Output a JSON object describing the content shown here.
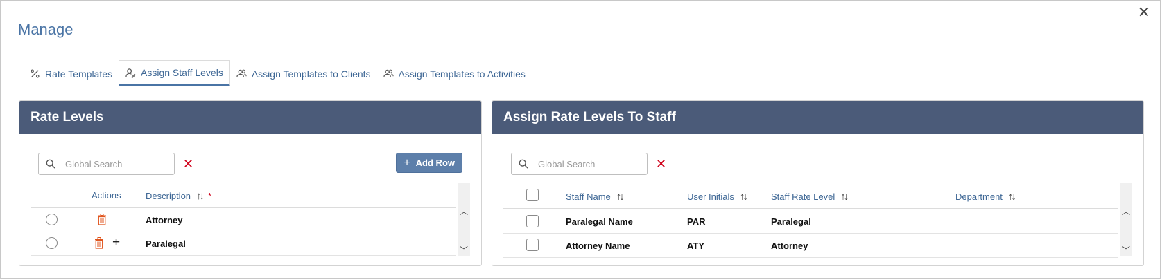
{
  "dialog": {
    "title": "Manage",
    "close_glyph": "✕"
  },
  "tabs": [
    {
      "label": "Rate Templates",
      "icon": "percent-icon",
      "active": false
    },
    {
      "label": "Assign Staff Levels",
      "icon": "user-edit-icon",
      "active": true
    },
    {
      "label": "Assign Templates to Clients",
      "icon": "users-icon",
      "active": false
    },
    {
      "label": "Assign Templates to Activities",
      "icon": "users-icon",
      "active": false
    }
  ],
  "rate_levels": {
    "title": "Rate Levels",
    "search_placeholder": "Global Search",
    "add_row_label": "Add Row",
    "columns": {
      "actions": "Actions",
      "description": "Description",
      "required_mark": "*"
    },
    "rows": [
      {
        "description": "Attorney"
      },
      {
        "description": "Paralegal"
      }
    ]
  },
  "assign_staff": {
    "title": "Assign Rate Levels To Staff",
    "search_placeholder": "Global Search",
    "columns": {
      "staff_name": "Staff Name",
      "user_initials": "User Initials",
      "staff_rate_level": "Staff Rate Level",
      "department": "Department"
    },
    "rows": [
      {
        "staff_name": "Paralegal Name",
        "initials": "PAR",
        "rate_level": "Paralegal",
        "department": ""
      },
      {
        "staff_name": "Attorney Name",
        "initials": "ATY",
        "rate_level": "Attorney",
        "department": ""
      }
    ]
  },
  "colors": {
    "accent": "#4a74a5",
    "panel_header": "#4b5b79",
    "button": "#5d7faa",
    "delete": "#e0561f",
    "clear": "#d0021b"
  }
}
